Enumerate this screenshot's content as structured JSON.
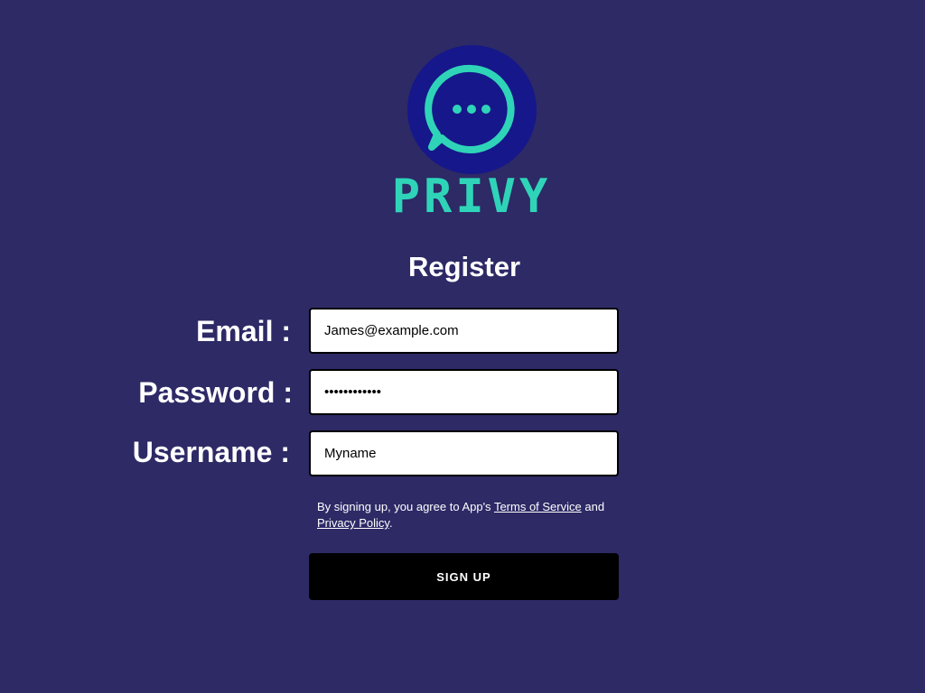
{
  "brand": {
    "name": "PRIVY",
    "logo_icon": "chat-bubble-icon",
    "colors": {
      "background": "#2d2a66",
      "logo_circle": "#16178a",
      "accent": "#2fd4b8"
    }
  },
  "form": {
    "title": "Register",
    "email": {
      "label": "Email :",
      "value": "James@example.com"
    },
    "password": {
      "label": "Password :",
      "value": "••••••••••••"
    },
    "username": {
      "label": "Username :",
      "value": "Myname"
    },
    "terms": {
      "prefix": "By signing up, you agree to App's ",
      "terms_link": "Terms of Service",
      "middle": " and ",
      "privacy_link": "Privacy Policy",
      "suffix": "."
    },
    "submit_label": "SIGN UP"
  }
}
